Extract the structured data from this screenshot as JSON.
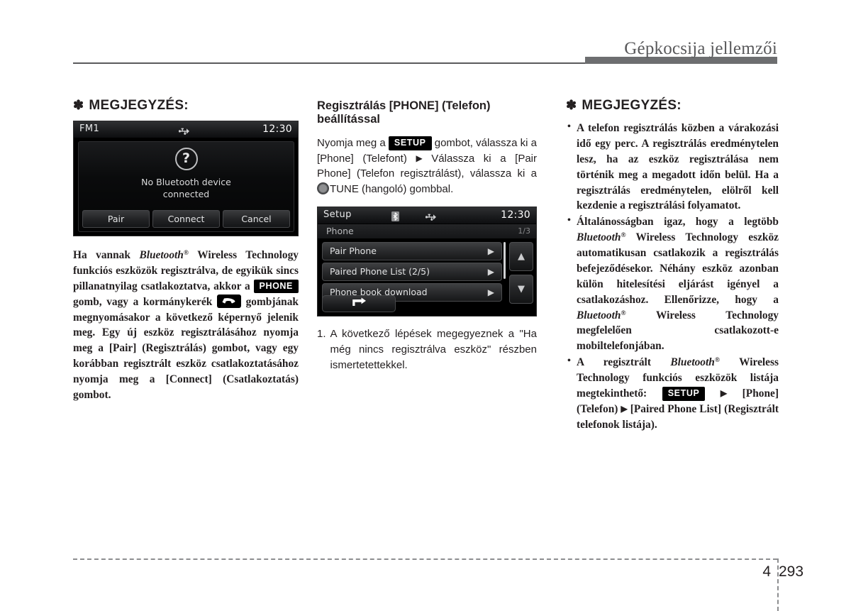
{
  "header": {
    "title": "Gépkocsija jellemzői"
  },
  "left_column": {
    "note_heading": "MEGJEGYZÉS:",
    "note_star": "✽",
    "screen": {
      "status_source": "FM1",
      "status_time": "12:30",
      "status_usb_icon": "usb-icon",
      "dialog_icon": "question-mark-icon",
      "dialog_message_line1": "No Bluetooth device",
      "dialog_message_line2": "connected",
      "buttons": [
        {
          "label": "Pair"
        },
        {
          "label": "Connect"
        },
        {
          "label": "Cancel"
        }
      ]
    },
    "body": {
      "p1_part1": "Ha vannak ",
      "p1_bluetooth": "Bluetooth",
      "p1_reg": "®",
      "p1_part2": " Wireless Technology funkciós eszközök regisztrálva, de egyikük sincs pillanatnyilag csatlakoztatva, akkor a ",
      "p1_badge_phone": "PHONE",
      "p1_part3": " gomb, vagy a kormánykerék ",
      "p1_part4": " gombjának megnyomásakor a következő képernyő jelenik meg. Egy új eszköz regisztrálásához nyomja meg a [Pair] (Regisztrálás) gombot, vagy egy korábban regisztrált eszköz csatlakoztatásához nyomja meg a [Connect] (Csatlakoztatás) gombot."
    }
  },
  "middle_column": {
    "section_heading_line1": "Regisztrálás [PHONE] (Telefon)",
    "section_heading_line2": "beállítással",
    "instruction": {
      "part1": "Nyomja meg a ",
      "badge_setup": "SETUP",
      "part2": " gombot, válassza ki a [Phone] (Telefont) ",
      "arrow1": "▶",
      "part3": " Válassza ki a [Pair Phone] (Telefon regisztrálást), válassza ki a ",
      "knob_icon": "tune-knob-icon",
      "part4": "TUNE (hangoló) gombbal."
    },
    "screen": {
      "status_title": "Setup",
      "status_time": "12:30",
      "status_bluetooth_icon": "bluetooth-icon",
      "status_usb_icon": "usb-icon",
      "sub_title": "Phone",
      "page_indicator": "1/3",
      "rows": [
        {
          "label": "Pair Phone",
          "arrow": "▶"
        },
        {
          "label": "Paired Phone List  (2/5)",
          "arrow": "▶"
        },
        {
          "label": "Phone book download",
          "arrow": "▶"
        }
      ],
      "scroll_up": "▲",
      "scroll_down": "▼",
      "back_icon": "return-arrow-icon"
    },
    "numbered_note": {
      "number": "1.",
      "text": "A következő lépések megegyeznek a \"Ha még nincs regisztrálva eszköz\" részben ismertetettekkel."
    }
  },
  "right_column": {
    "note_heading": "MEGJEGYZÉS:",
    "note_star": "✽",
    "bullets": [
      {
        "text": "A telefon regisztrálás közben a várakozási idő egy perc. A regisztrálás eredménytelen lesz, ha az eszköz regisztrálása nem történik meg a megadott időn belül. Ha a regisztrálás eredménytelen, elölről kell kezdenie a regisztrálási folyamatot."
      },
      {
        "part1": "Általánosságban igaz, hogy a legtöbb ",
        "bluetooth1": "Bluetooth",
        "reg1": "®",
        "part2": " Wireless Technology eszköz automatikusan csatlakozik a regisztrálás befejeződésekor. Néhány eszköz azonban külön hitelesítési eljárást igényel a csatlakozáshoz. Ellenőrizze, hogy a ",
        "bluetooth2": "Bluetooth",
        "reg2": "®",
        "part3": " Wireless Technology megfelelően csatlakozott-e mobiltelefonjában."
      },
      {
        "part1": "A regisztrált ",
        "bluetooth1": "Bluetooth",
        "reg1": "®",
        "part2": " Wireless Technology funkciós eszközök listája megtekinthető: ",
        "badge_setup": "SETUP",
        "arrow1": "▶",
        "part3": " [Phone] (Telefon) ",
        "arrow2": "▶",
        "part4": " [Paired Phone List] (Regisztrált telefonok listája)."
      }
    ]
  },
  "footer": {
    "chapter": "4",
    "page": "293"
  }
}
